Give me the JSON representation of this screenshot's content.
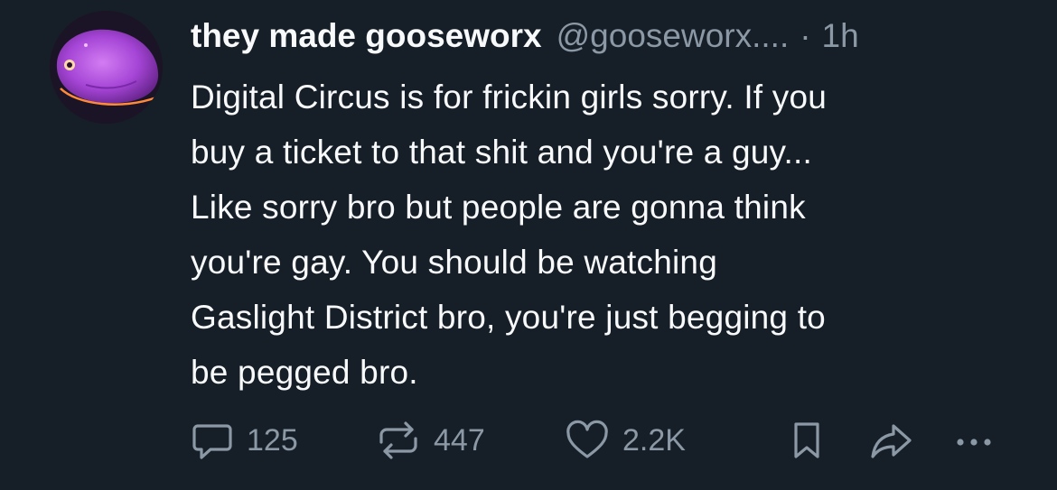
{
  "post": {
    "display_name": "they made gooseworx",
    "handle": "@gooseworx....",
    "separator": "·",
    "time": "1h",
    "text_lines": [
      "Digital Circus is for frickin girls sorry. If you",
      "buy a ticket to that shit and you're a guy...",
      "Like sorry bro but people are gonna think",
      "you're gay. You should be watching",
      "Gaslight District bro, you're just begging to",
      "be pegged bro."
    ]
  },
  "actions": {
    "replies": "125",
    "reposts": "447",
    "likes": "2.2K"
  },
  "icons": {
    "reply": "speech-bubble-icon",
    "repost": "repost-arrows-icon",
    "like": "heart-icon",
    "bookmark": "bookmark-icon",
    "share": "share-arrow-icon",
    "more": "more-dots-icon"
  },
  "colors": {
    "background": "#161e27",
    "text": "#f7f9fa",
    "muted": "#8b98a5",
    "avatar_accent": "#b24fe0"
  }
}
